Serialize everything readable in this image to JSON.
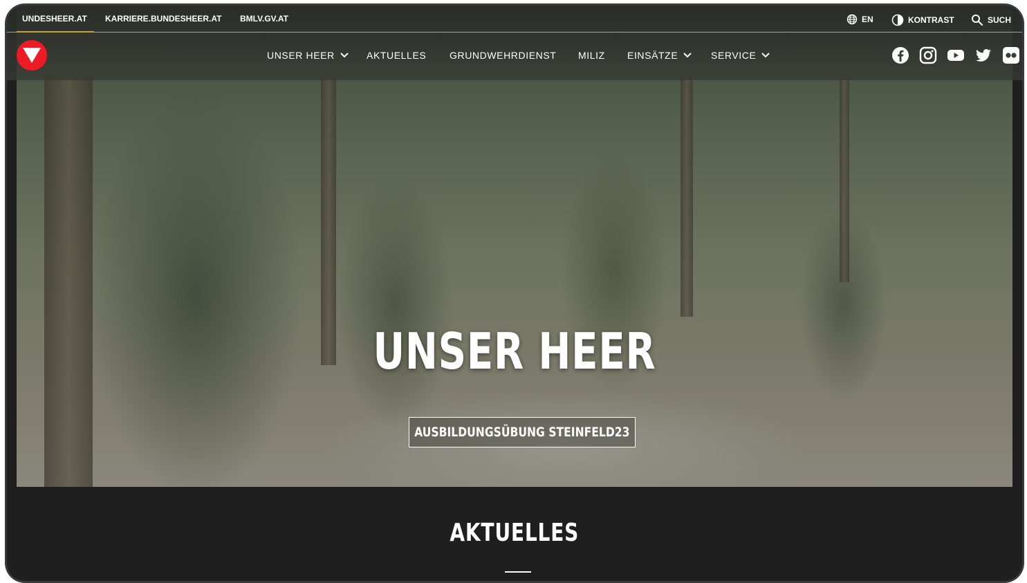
{
  "topbar": {
    "links": [
      {
        "label": "UNDESHEER.AT",
        "active": true
      },
      {
        "label": "KARRIERE.BUNDESHEER.AT",
        "active": false
      },
      {
        "label": "BMLV.GV.AT",
        "active": false
      }
    ],
    "language_label": "EN",
    "contrast_label": "KONTRAST",
    "search_label": "SUCH"
  },
  "nav": {
    "items": [
      {
        "label": "UNSER HEER",
        "has_dropdown": true
      },
      {
        "label": "AKTUELLES",
        "has_dropdown": false
      },
      {
        "label": "GRUNDWEHRDIENST",
        "has_dropdown": false
      },
      {
        "label": "MILIZ",
        "has_dropdown": false
      },
      {
        "label": "EINSÄTZE",
        "has_dropdown": true
      },
      {
        "label": "SERVICE",
        "has_dropdown": true
      }
    ]
  },
  "social": [
    "facebook-icon",
    "instagram-icon",
    "youtube-icon",
    "twitter-icon",
    "flickr-icon"
  ],
  "hero": {
    "title": "UNSER HEER",
    "cta_label": "AUSBILDUNGSÜBUNG STEINFELD23"
  },
  "section": {
    "title": "AKTUELLES"
  },
  "colors": {
    "accent": "#c9a227",
    "logo_red": "#ed1c24",
    "section_bg": "#1f1f1f"
  }
}
